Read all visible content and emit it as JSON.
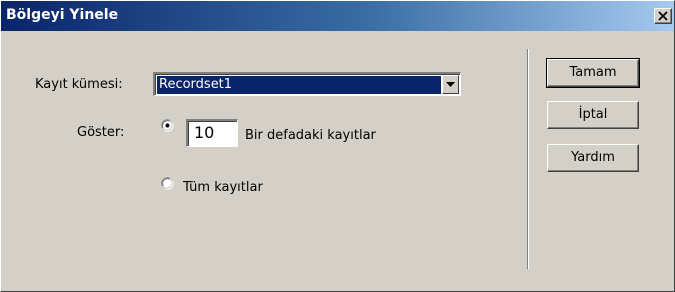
{
  "window": {
    "title": "Bölgeyi Yinele"
  },
  "form": {
    "recordset_label": "Kayıt kümesi:",
    "recordset_value": "Recordset1",
    "show_label": "Göster:",
    "count_value": "10",
    "batch_option_label": "Bir defadaki kayıtlar",
    "batch_option_selected": true,
    "all_option_label": "Tüm kayıtlar",
    "all_option_selected": false
  },
  "buttons": {
    "ok_label": "Tamam",
    "cancel_label": "İptal",
    "help_label": "Yardım"
  },
  "colors": {
    "titlebar_start": "#0a246a",
    "titlebar_end": "#a6caf0",
    "selection": "#0a246a",
    "face": "#d4d0c8"
  },
  "icons": {
    "close": "close-icon",
    "dropdown": "chevron-down-icon"
  }
}
